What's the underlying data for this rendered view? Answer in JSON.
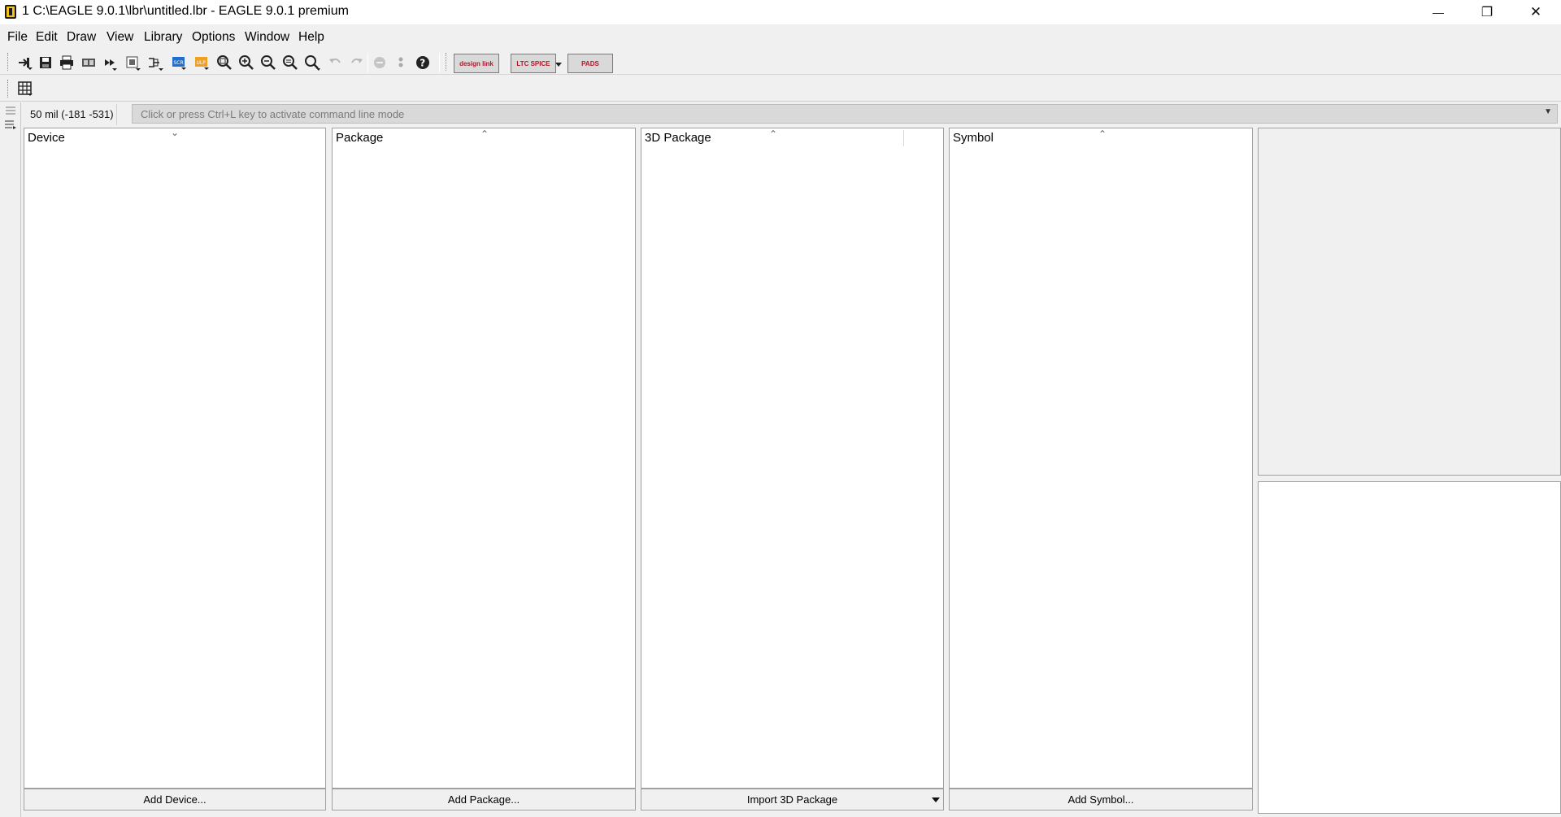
{
  "window": {
    "title": "1 C:\\EAGLE 9.0.1\\lbr\\untitled.lbr - EAGLE 9.0.1 premium",
    "minimize_glyph": "—",
    "maximize_glyph": "❐",
    "close_glyph": "✕"
  },
  "menu": {
    "items": [
      "File",
      "Edit",
      "Draw",
      "View",
      "Library",
      "Options",
      "Window",
      "Help"
    ]
  },
  "toolbar": {
    "icons": [
      "open-icon",
      "save-icon",
      "print-icon",
      "cam-processor-icon",
      "run-script-icon",
      "board-icon",
      "schematic-icon",
      "scr-script-icon",
      "ulp-icon",
      "zoom-fit-icon",
      "zoom-in-icon",
      "zoom-out-icon",
      "zoom-select-icon",
      "zoom-area-icon",
      "undo-icon",
      "redo-icon",
      "stop-icon",
      "go-icon",
      "help-icon"
    ],
    "brands": {
      "designlink": "design link",
      "ltspice": "LTC SPICE",
      "pads": "PADS"
    }
  },
  "toolbar2": {
    "icons": [
      "grid-icon"
    ]
  },
  "status": {
    "coordinates": "50 mil (-181 -531)",
    "command_placeholder": "Click or press Ctrl+L key to activate command line mode"
  },
  "panels": {
    "device": {
      "header": "Device",
      "button": "Add Device..."
    },
    "package": {
      "header": "Package",
      "button": "Add Package..."
    },
    "package3d": {
      "header": "3D Package",
      "button": "Import 3D Package"
    },
    "symbol": {
      "header": "Symbol",
      "button": "Add Symbol..."
    }
  },
  "colors": {
    "window_bg": "#f0f0f0",
    "panel_bg": "#ffffff",
    "command_bg": "#d9d9d9",
    "brand_red": "#b0182a"
  }
}
